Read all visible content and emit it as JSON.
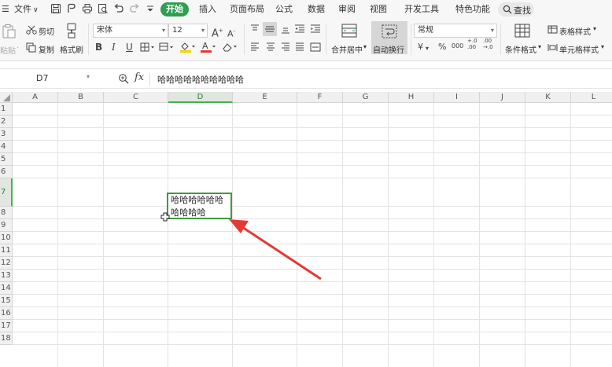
{
  "menubar": {
    "file_label": "文件",
    "tabs": [
      "开始",
      "插入",
      "页面布局",
      "公式",
      "数据",
      "审阅",
      "视图",
      "开发工具",
      "特色功能"
    ],
    "search_label": "查找"
  },
  "ribbon": {
    "paste_label": "粘贴",
    "cut_label": "剪切",
    "copy_label": "复制",
    "format_painter_label": "格式刷",
    "font_name": "宋体",
    "font_size": "12",
    "merge_center_label": "合并居中",
    "wrap_text_label": "自动换行",
    "number_format": "常规",
    "conditional_format_label": "条件格式",
    "table_style_label": "表格样式",
    "cell_style_label": "单元格样式",
    "bold": "B",
    "italic": "I",
    "underline": "U",
    "currency_symbol": "¥",
    "percent_symbol": "%",
    "thousands_label": "000",
    "increase_decimal": "+.0\n.00",
    "decrease_decimal": ".00\n→.0",
    "grow_font": "A",
    "shrink_font": "A"
  },
  "formula_bar": {
    "name_box": "D7",
    "fx_label": "fx",
    "content": "哈哈哈哈哈哈哈哈哈哈"
  },
  "sheet": {
    "columns": [
      "A",
      "B",
      "C",
      "D",
      "E",
      "F",
      "G",
      "H",
      "I",
      "J",
      "K",
      "L"
    ],
    "selected_column": "D",
    "rows": [
      "1",
      "2",
      "3",
      "4",
      "5",
      "6",
      "7",
      "8",
      "9",
      "10",
      "11",
      "12",
      "13",
      "14",
      "15",
      "16",
      "17",
      "18"
    ],
    "selected_row": "7",
    "active_cell": {
      "ref": "D7",
      "value": "哈哈哈哈哈哈哈哈哈哈"
    }
  },
  "colors": {
    "accent_green": "#2e9e4f",
    "selection_border": "#3d9b3d",
    "annotation_arrow": "#e53935"
  }
}
